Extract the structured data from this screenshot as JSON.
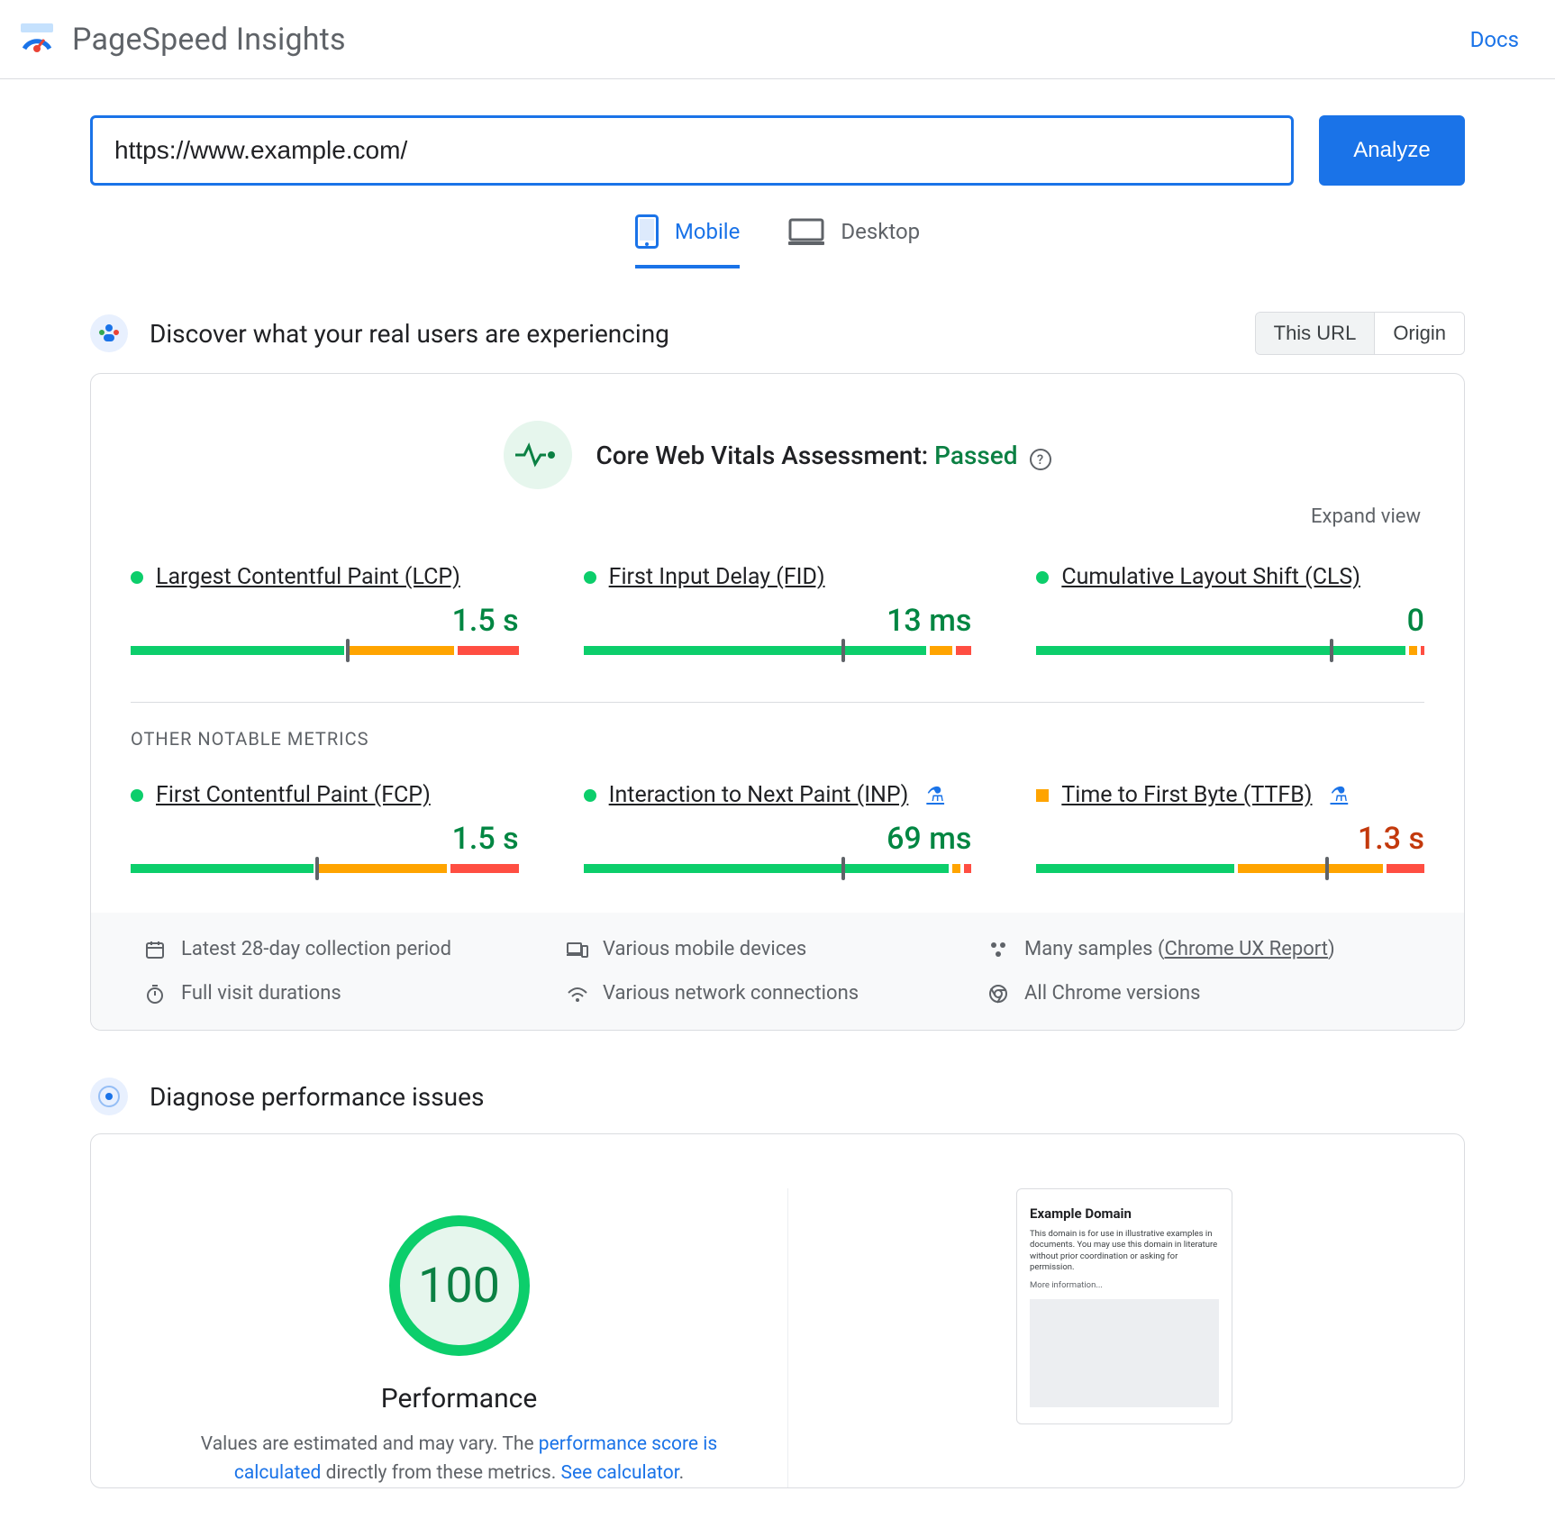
{
  "header": {
    "app_title": "PageSpeed Insights",
    "docs_label": "Docs"
  },
  "url_bar": {
    "value": "https://www.example.com/",
    "analyze_label": "Analyze"
  },
  "tabs": {
    "mobile": "Mobile",
    "desktop": "Desktop",
    "active": "mobile"
  },
  "field_section": {
    "title": "Discover what your real users are experiencing",
    "seg": {
      "this_url": "This URL",
      "origin": "Origin",
      "active": "this_url"
    },
    "assessment_prefix": "Core Web Vitals Assessment: ",
    "assessment_status": "Passed",
    "expand_label": "Expand view",
    "other_metrics_label": "OTHER NOTABLE METRICS",
    "metrics_primary": [
      {
        "name": "Largest Contentful Paint (LCP)",
        "value": "1.5 s",
        "status": "green",
        "dist": {
          "good": 56,
          "ni": 28,
          "poor": 16,
          "marker": 56
        }
      },
      {
        "name": "First Input Delay (FID)",
        "value": "13 ms",
        "status": "green",
        "dist": {
          "good": 90,
          "ni": 6,
          "poor": 4,
          "marker": 67
        }
      },
      {
        "name": "Cumulative Layout Shift (CLS)",
        "value": "0",
        "status": "green",
        "dist": {
          "good": 97,
          "ni": 2,
          "poor": 1,
          "marker": 76
        }
      }
    ],
    "metrics_secondary": [
      {
        "name": "First Contentful Paint (FCP)",
        "value": "1.5 s",
        "status": "green",
        "experimental": false,
        "dist": {
          "good": 48,
          "ni": 34,
          "poor": 18,
          "marker": 48
        }
      },
      {
        "name": "Interaction to Next Paint (INP)",
        "value": "69 ms",
        "status": "green",
        "experimental": true,
        "dist": {
          "good": 96,
          "ni": 2,
          "poor": 2,
          "marker": 67
        }
      },
      {
        "name": "Time to First Byte (TTFB)",
        "value": "1.3 s",
        "status": "orange",
        "experimental": true,
        "dist": {
          "good": 52,
          "ni": 38,
          "poor": 10,
          "marker": 75
        }
      }
    ],
    "info_items": {
      "period": "Latest 28-day collection period",
      "devices": "Various mobile devices",
      "samples_prefix": "Many samples (",
      "samples_link": "Chrome UX Report",
      "samples_suffix": ")",
      "durations": "Full visit durations",
      "networks": "Various network connections",
      "chrome": "All Chrome versions"
    }
  },
  "lab_section": {
    "title": "Diagnose performance issues",
    "score": "100",
    "score_label": "Performance",
    "desc_prefix": "Values are estimated and may vary. The ",
    "desc_link1": "performance score is calculated",
    "desc_mid": " directly from these metrics. ",
    "desc_link2": "See calculator",
    "desc_suffix": ".",
    "thumbnail": {
      "title": "Example Domain",
      "body": "This domain is for use in illustrative examples in documents. You may use this domain in literature without prior coordination or asking for permission.",
      "more": "More information..."
    }
  }
}
